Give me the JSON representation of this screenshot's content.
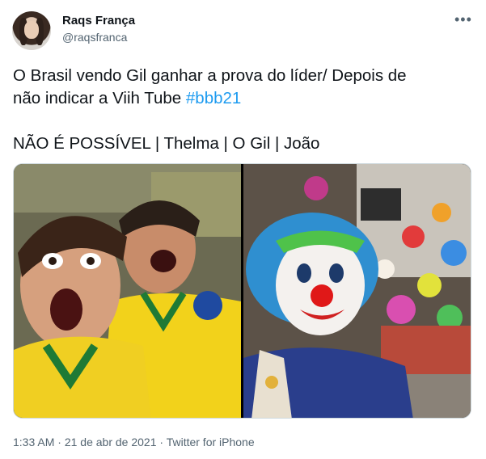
{
  "author": {
    "name": "Raqs França",
    "handle": "@raqsfranca",
    "avatar_icon": "user-avatar"
  },
  "more_icon": "more-options-icon",
  "tweet": {
    "line1": "O Brasil vendo Gil ganhar a prova do líder/ Depois de",
    "line2_text": "não indicar a Viih Tube ",
    "hashtag": "#bbb21",
    "line3": "NÃO É POSSÍVEL | Thelma | O Gil | João"
  },
  "media": {
    "left_photo": "two excited fans in Brazil jerseys",
    "right_photo": "clown with blue hair and red nose among many clowns"
  },
  "footer": {
    "time": "1:33 AM",
    "date": "21 de abr de 2021",
    "source": "Twitter for iPhone"
  },
  "colors": {
    "link": "#1d9bf0",
    "secondary_text": "#536471",
    "primary_text": "#0f1419"
  }
}
